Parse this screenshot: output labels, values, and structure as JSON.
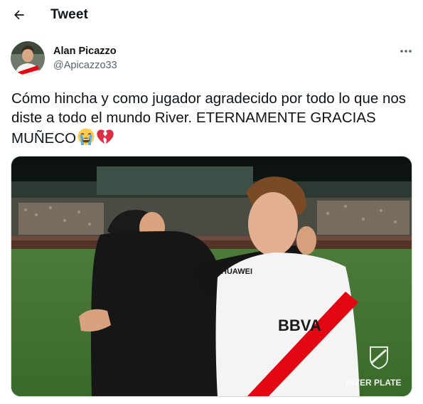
{
  "header": {
    "title": "Tweet",
    "back_icon": "arrow-left-icon"
  },
  "author": {
    "display_name": "Alan Picazzo",
    "handle": "@Apicazzo33",
    "avatar": "avatar-photo"
  },
  "more_icon": "more-horizontal-icon",
  "tweet": {
    "text": "Cómo hincha y como jugador agradecido por todo lo que nos diste a todo el mundo River. ETERNAMENTE GRACIAS MUÑECO",
    "emojis": [
      "loudly-crying-face-emoji",
      "broken-heart-emoji"
    ]
  },
  "media": {
    "description_icon": "photo",
    "watermark": "RIVER PLATE",
    "jersey_sponsor": "BBVA",
    "jersey_brand": "HUAWEI"
  },
  "colors": {
    "text": "#0f1419",
    "secondary": "#536471",
    "border": "#cfd9de",
    "river_red": "#e30613"
  }
}
